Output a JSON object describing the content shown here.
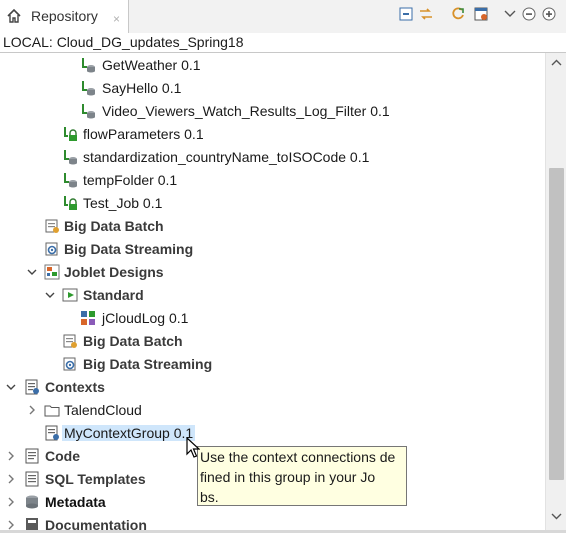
{
  "tab": {
    "title": "Repository",
    "close": "×"
  },
  "path": "LOCAL: Cloud_DG_updates_Spring18",
  "tree": [
    {
      "label": "GetWeather 0.1"
    },
    {
      "label": "SayHello 0.1"
    },
    {
      "label": "Video_Viewers_Watch_Results_Log_Filter 0.1"
    },
    {
      "label": "flowParameters 0.1"
    },
    {
      "label": "standardization_countryName_toISOCode 0.1"
    },
    {
      "label": "tempFolder 0.1"
    },
    {
      "label": "Test_Job 0.1"
    },
    {
      "label": "Big Data Batch"
    },
    {
      "label": "Big Data Streaming"
    },
    {
      "label": "Joblet Designs"
    },
    {
      "label": "Standard"
    },
    {
      "label": "jCloudLog 0.1"
    },
    {
      "label": "Big Data Batch"
    },
    {
      "label": "Big Data Streaming"
    },
    {
      "label": "Contexts"
    },
    {
      "label": "TalendCloud"
    },
    {
      "label": "MyContextGroup 0.1"
    },
    {
      "label": "Code"
    },
    {
      "label": "SQL Templates"
    },
    {
      "label": "Metadata"
    },
    {
      "label": "Documentation"
    }
  ],
  "tooltip": {
    "lines": [
      "Use the context connections de",
      "fined in this group in your Jo",
      "bs."
    ]
  },
  "colors": {
    "selection": "#cfe6fb",
    "tooltip_bg": "#ffffe1",
    "job_icon": "#2e8b2e"
  }
}
